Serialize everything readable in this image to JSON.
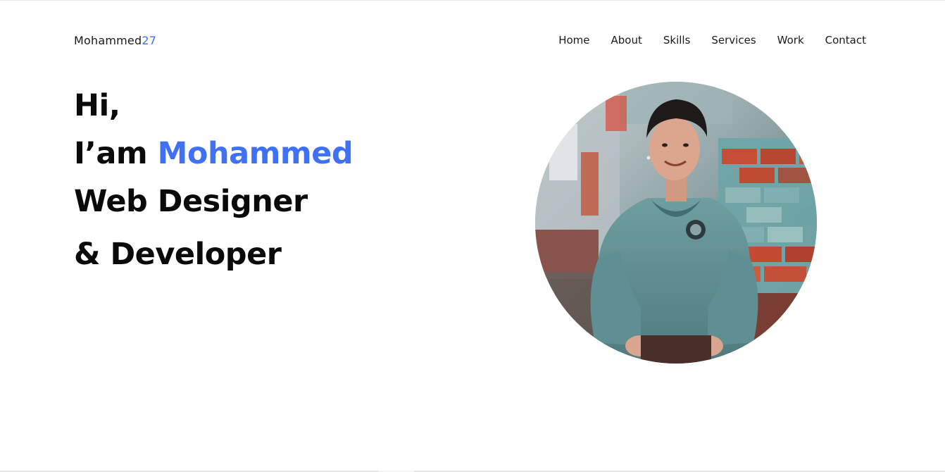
{
  "header": {
    "logo_main": "Mohammed",
    "logo_accent": "27",
    "nav": [
      {
        "label": "Home"
      },
      {
        "label": "About"
      },
      {
        "label": "Skills"
      },
      {
        "label": "Services"
      },
      {
        "label": "Work"
      },
      {
        "label": "Contact"
      }
    ]
  },
  "hero": {
    "greeting": "Hi,",
    "intro_prefix": "I’am ",
    "name": "Mohammed",
    "role_line1": "Web Designer",
    "role_line2": "& Developer"
  },
  "colors": {
    "accent": "#4070f4",
    "text": "#0a0a0a",
    "background": "#ffffff"
  }
}
